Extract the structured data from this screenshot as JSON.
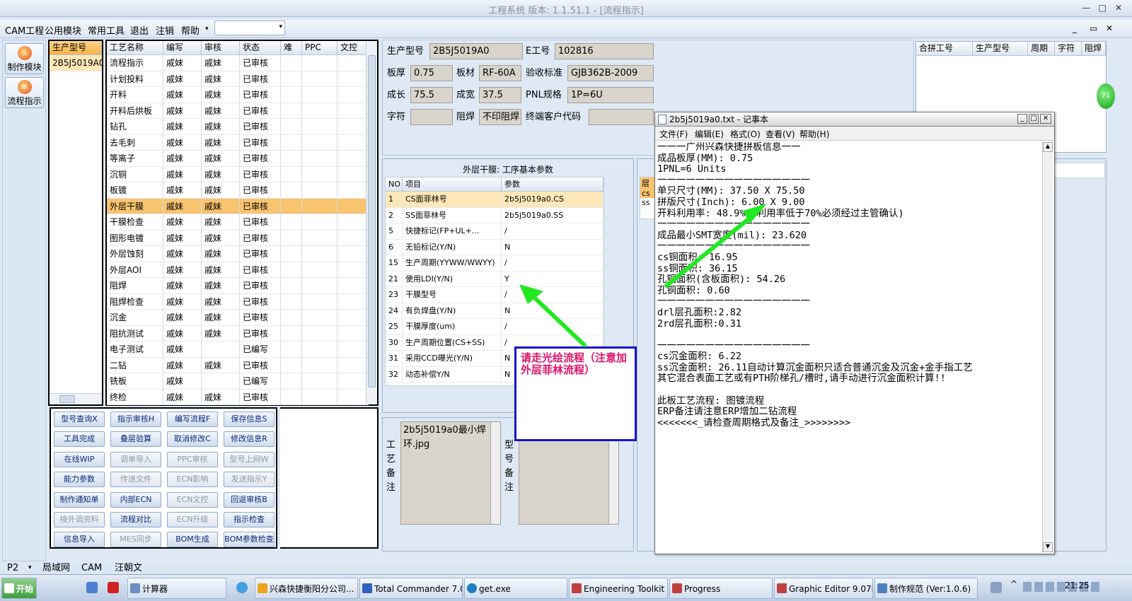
{
  "window": {
    "title": "工程系统   版本: 1.1.51.1 - [流程指示]",
    "min": "—",
    "max": "□",
    "close": "✕",
    "child_min": "_",
    "child_max": "▭",
    "child_close": "✕"
  },
  "menu": {
    "items": [
      "CAM工程",
      "公用模块",
      "常用工具",
      "退出",
      "注销",
      "帮助"
    ],
    "help_arrow": "▾",
    "combo_value": "",
    "combo_arrow": "▾"
  },
  "sidebar": {
    "make_label": "制作模块",
    "flow_label": "流程指示"
  },
  "model_list": {
    "header": "生产型号",
    "items": [
      "2B5J5019A0"
    ]
  },
  "process": {
    "headers": [
      "工艺名称",
      "编写",
      "审核",
      "状态",
      "难",
      "PPC",
      "文控"
    ],
    "rows": [
      [
        "流程指示",
        "戚妹",
        "戚妹",
        "已审核"
      ],
      [
        "计划投料",
        "戚妹",
        "戚妹",
        "已审核"
      ],
      [
        "开料",
        "戚妹",
        "戚妹",
        "已审核"
      ],
      [
        "开料后烘板",
        "戚妹",
        "戚妹",
        "已审核"
      ],
      [
        "钻孔",
        "戚妹",
        "戚妹",
        "已审核"
      ],
      [
        "去毛刺",
        "戚妹",
        "戚妹",
        "已审核"
      ],
      [
        "等离子",
        "戚妹",
        "戚妹",
        "已审核"
      ],
      [
        "沉铜",
        "戚妹",
        "戚妹",
        "已审核"
      ],
      [
        "板镀",
        "戚妹",
        "戚妹",
        "已审核"
      ],
      [
        "外层干膜",
        "戚妹",
        "戚妹",
        "已审核"
      ],
      [
        "干膜检查",
        "戚妹",
        "戚妹",
        "已审核"
      ],
      [
        "图形电镀",
        "戚妹",
        "戚妹",
        "已审核"
      ],
      [
        "外层蚀刻",
        "戚妹",
        "戚妹",
        "已审核"
      ],
      [
        "外层AOI",
        "戚妹",
        "戚妹",
        "已审核"
      ],
      [
        "阻焊",
        "戚妹",
        "戚妹",
        "已审核"
      ],
      [
        "阻焊检查",
        "戚妹",
        "戚妹",
        "已审核"
      ],
      [
        "沉金",
        "戚妹",
        "戚妹",
        "已审核"
      ],
      [
        "阻抗测试",
        "戚妹",
        "戚妹",
        "已审核"
      ],
      [
        "电子测试",
        "戚妹",
        "",
        "已编写"
      ],
      [
        "二钻",
        "戚妹",
        "戚妹",
        "已审核"
      ],
      [
        "铣板",
        "戚妹",
        "",
        "已编写"
      ],
      [
        "终检",
        "戚妹",
        "戚妹",
        "已审核"
      ]
    ],
    "selected_index": 9
  },
  "buttons": [
    [
      "型号查询X",
      "指示审核H",
      "编写流程F",
      "保存信息S"
    ],
    [
      "工具完成",
      "叠层验算",
      "取消修改C",
      "修改信息R"
    ],
    [
      "在线WIP",
      "调单导入",
      "PPC审核",
      "型号上网W"
    ],
    [
      "能力参数",
      "传送文件",
      "ECN影响",
      "发送指示Y"
    ],
    [
      "制作通知单",
      "内部ECN",
      "ECN文控",
      "回退审核B"
    ],
    [
      "接外调资料",
      "流程对比",
      "ECN升级",
      "指示检查"
    ],
    [
      "信息导入",
      "MES同步",
      "BOM生成",
      "BOM参数检查"
    ]
  ],
  "buttons_disabled": [
    [
      false,
      false,
      false,
      false
    ],
    [
      false,
      false,
      false,
      false
    ],
    [
      false,
      true,
      true,
      true
    ],
    [
      false,
      true,
      true,
      true
    ],
    [
      false,
      false,
      true,
      false
    ],
    [
      true,
      false,
      true,
      false
    ],
    [
      false,
      true,
      false,
      false
    ]
  ],
  "info": {
    "model_label": "生产型号",
    "model_value": "2B5J5019A0",
    "e_label": "E工号",
    "e_value": "102816",
    "thick_label": "板厚",
    "thick_value": "0.75",
    "mat_label": "板材",
    "mat_value": "RF-60A",
    "std_label": "验收标准",
    "std_value": "GJB362B-2009",
    "len_label": "成长",
    "len_value": "75.5",
    "wid_label": "成宽",
    "wid_value": "37.5",
    "pnl_label": "PNL规格",
    "pnl_value": "1P=6U",
    "char_label": "字符",
    "char_value": "",
    "mask_label": "阻焊",
    "mask_value": "不印阻焊",
    "cust_label": "终端客户代码",
    "cust_value": ""
  },
  "params": {
    "title": "外层干膜: 工序基本参数",
    "headers": [
      "NO",
      "项目",
      "参数"
    ],
    "rows": [
      [
        "1",
        "CS面菲林号",
        "2b5j5019a0.CS"
      ],
      [
        "2",
        "SS面菲林号",
        "2b5j5019a0.SS"
      ],
      [
        "5",
        "快捷标记(FP+UL+...",
        "/"
      ],
      [
        "6",
        "无铅标记(Y/N)",
        "N"
      ],
      [
        "15",
        "生产周期(YYWW/WWYY)",
        "/"
      ],
      [
        "21",
        "使用LDI(Y/N)",
        "Y"
      ],
      [
        "23",
        "干膜型号",
        "/"
      ],
      [
        "24",
        "有负焊盘(Y/N)",
        "N"
      ],
      [
        "25",
        "干膜厚度(um)",
        "/"
      ],
      [
        "30",
        "生产周期位置(CS+SS)",
        "/"
      ],
      [
        "31",
        "采用CCD曝光(Y/N)",
        "N"
      ],
      [
        "32",
        "动态补偿Y/N",
        "N"
      ]
    ]
  },
  "remarks": {
    "label": "工艺备注",
    "file_text": "2b5j5019a0最小焊环.jpg",
    "model_label": "型号备注"
  },
  "annotation": {
    "text": "请走光绘流程（注意加外层菲林流程）"
  },
  "right_table": {
    "headers": [
      "合拼工号",
      "生产型号",
      "周期",
      "字符",
      "阻焊"
    ]
  },
  "side_tab": {
    "labels": [
      "层",
      "cs",
      "ss"
    ]
  },
  "notepad": {
    "title": "2b5j5019a0.txt - 记事本",
    "menu": [
      "文件(F)",
      "编辑(E)",
      "格式(O)",
      "查看(V)",
      "帮助(H)"
    ],
    "content": "一一一广州兴森快捷拼板信息一一\n成品板厚(MM): 0.75\n1PNL=6 Units\n一一一一一一一一一一一一一一一一\n单只尺寸(MM): 37.50 X 75.50\n拼版尺寸(Inch): 6.00 X 9.00\n开料利用率: 48.9% (利用率低于70%必须经过主管确认)\n一一一一一一一一一一一一一一一一\n成品最小SMT宽度(mil): 23.620\n一一一一一一一一一一一一一一一一\ncs铜面积: 16.95\nss铜面积: 36.15\n孔铜面积(含板面积): 54.26\n孔铜面积: 0.60\n一一一一一一一一一一一一一一一一\ndrl层孔面积:2.82\n2rd层孔面积:0.31\n\n一一一一一一一一一一一一一一一一\ncs沉金面积: 6.22\nss沉金面积: 26.11自动计算沉金面积只适合普通沉金及沉金+金手指工艺\n其它混合表面工艺或有PTH阶梯孔/槽时,请手动进行沉金面积计算!!\n\n此板工艺流程: 图镀流程\nERP备注请注意ERP增加二钻流程\n<<<<<<<_请检查周期格式及备注_>>>>>>>>"
  },
  "bottom_tabs": {
    "p": "P2",
    "arrow": "▾",
    "items": [
      "局域网",
      "CAM",
      "汪朝文"
    ]
  },
  "taskbar": {
    "start": "开始",
    "items": [
      "计算器",
      "兴森快捷衡阳分公司...",
      "Total Commander 7.0 ...",
      "get.exe",
      "Engineering Toolkit 9....",
      "Progress",
      "Graphic Editor 9.07b2 ...",
      "制作规范 (Ver:1.0.6)"
    ],
    "clock": "21:25",
    "badge": "71"
  },
  "colors": {
    "accent": "#f9c46e",
    "annotation_border": "#1515c8",
    "annotation_text": "#e0106a",
    "arrow": "#22e822"
  }
}
